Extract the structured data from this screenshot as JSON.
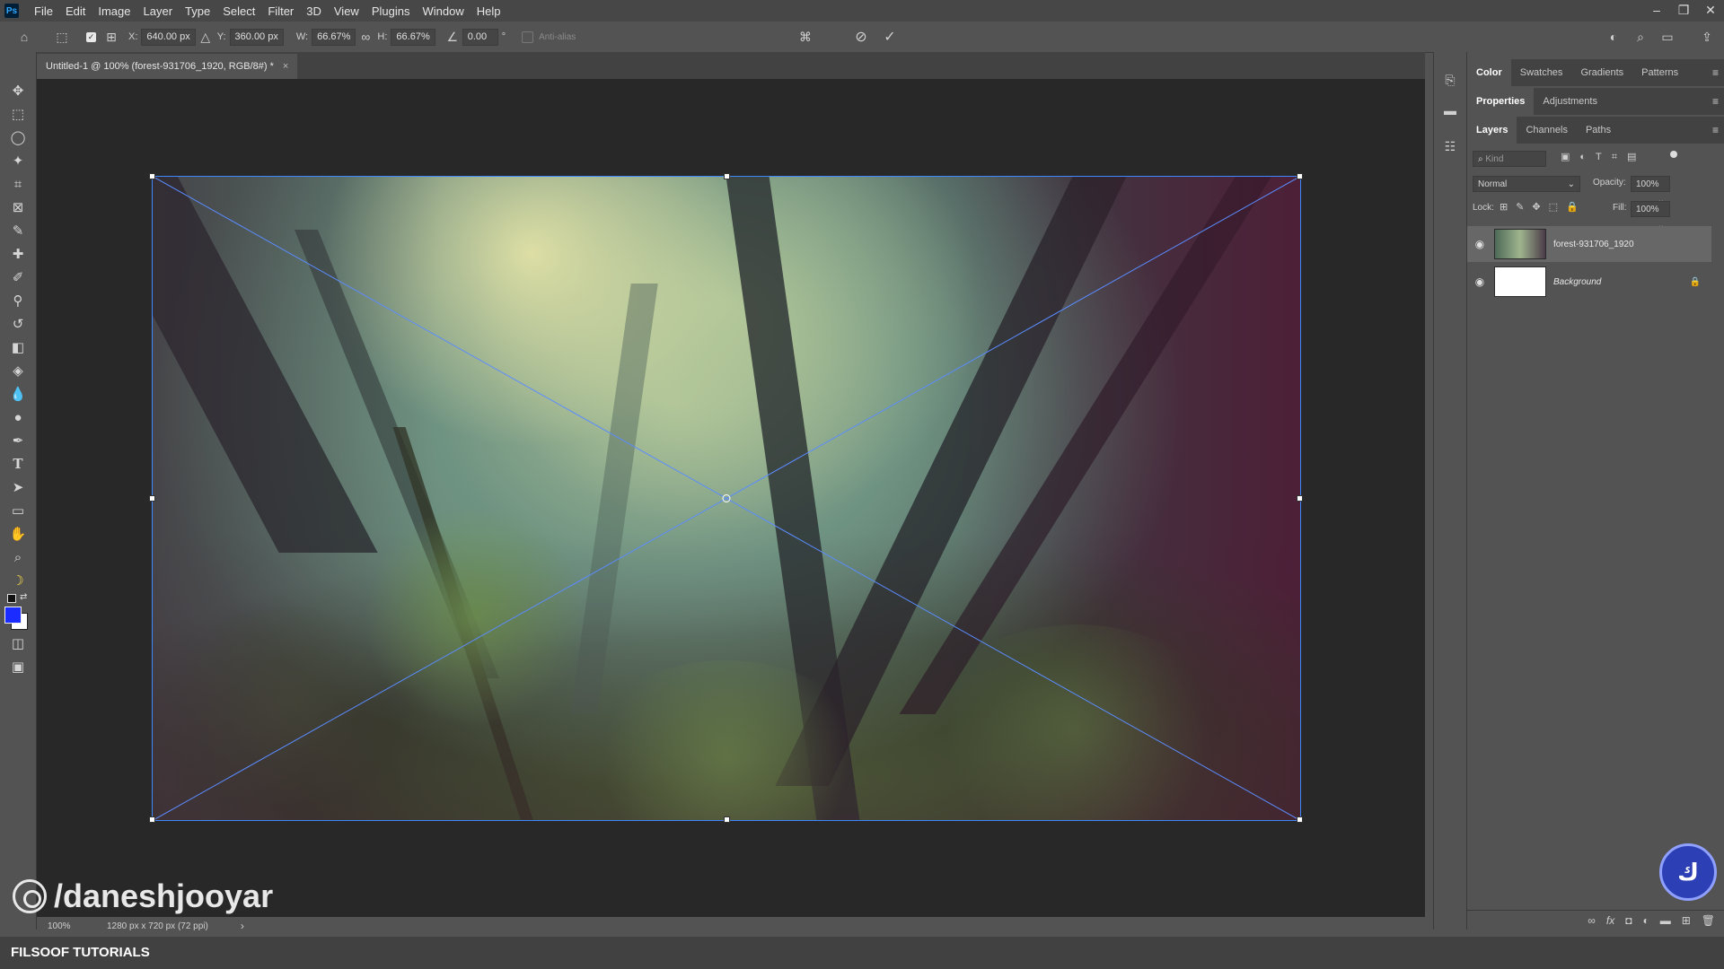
{
  "app": {
    "logo_text": "Ps"
  },
  "menubar": {
    "items": [
      "File",
      "Edit",
      "Image",
      "Layer",
      "Type",
      "Select",
      "Filter",
      "3D",
      "View",
      "Plugins",
      "Window",
      "Help"
    ],
    "window_controls": [
      "–",
      "❐",
      "✕"
    ]
  },
  "options_bar": {
    "x_label": "X:",
    "x_value": "640.00 px",
    "y_label": "Y:",
    "y_value": "360.00 px",
    "w_label": "W:",
    "w_value": "66.67%",
    "h_label": "H:",
    "h_value": "66.67%",
    "angle_value": "0.00",
    "degree": "°",
    "antialias_label": "Anti-alias"
  },
  "document": {
    "tab_title": "Untitled-1 @ 100% (forest-931706_1920, RGB/8#) *",
    "tab_close": "×"
  },
  "status": {
    "zoom": "100%",
    "doc_info": "1280 px x 720 px (72 ppi)",
    "arrow": "›"
  },
  "panels": {
    "group1_tabs": [
      "Color",
      "Swatches",
      "Gradients",
      "Patterns"
    ],
    "group2_tabs": [
      "Properties",
      "Adjustments"
    ],
    "group3_tabs": [
      "Layers",
      "Channels",
      "Paths"
    ],
    "kind_placeholder": "Kind",
    "blend_mode": "Normal",
    "opacity_label": "Opacity:",
    "opacity_value": "100%",
    "lock_label": "Lock:",
    "fill_label": "Fill:",
    "fill_value": "100%",
    "layers": [
      {
        "name": "forest-931706_1920"
      },
      {
        "name": "Background"
      }
    ]
  },
  "watermark": {
    "text": "/daneshjooyar"
  },
  "brand": {
    "text": "FILSOOF TUTORIALS"
  },
  "colors": {
    "accent": "#3f87ff",
    "foreground_swatch": "#1a2cff",
    "background_swatch": "#ffffff",
    "badge": "#2c3fb5"
  }
}
